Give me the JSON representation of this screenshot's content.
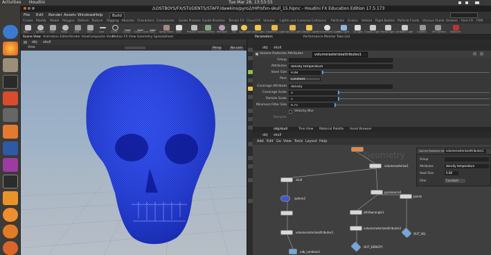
{
  "system": {
    "app_name": "Activities",
    "app_menu": "Houdini",
    "clock": "Tue Mar 28, 13:53:55"
  },
  "launcher": {
    "items": [
      "help-icon",
      "firefox-icon",
      "files-icon",
      "terminal-icon",
      "settings-icon",
      "camera-icon",
      "software-icon",
      "bluetooth-icon",
      "screen-icon",
      "houdini-fx-icon",
      "houdini-icon",
      "houdini-alt-icon",
      "houdini-icon-2"
    ]
  },
  "window": {
    "title": "/LOSTBOYS/FX/STUDENTS/STAFF/dawkins/pyro2/HIP/sfxn-skull_15.hipnc - Houdini FX Education Edition 17.5.173"
  },
  "menubar": {
    "items": [
      "File",
      "Edit",
      "Render",
      "Assets",
      "Windows",
      "Help"
    ],
    "desktop": "Build"
  },
  "shelf_tabs": [
    "Create",
    "Modify",
    "Model",
    "Polygon",
    "Deform",
    "Texture",
    "Rigging",
    "Muscles",
    "Characters",
    "Constraints",
    "Guide Process",
    "Guide Brushes",
    "Terrain FX",
    "Cloud FX",
    "Volume",
    "Lights and Cameras",
    "Collisions",
    "Particles",
    "Grains",
    "Vellum",
    "Rigid Bodies",
    "Particle Fluids",
    "Viscous Fluids",
    "Oceans",
    "Pyro FX",
    "FEM",
    "Wires",
    "Crowds",
    "Drive Simulation"
  ],
  "shelf_tools": [
    "Box",
    "Sphere",
    "Tube",
    "Torus",
    "Grid",
    "Null",
    "Line",
    "Circle",
    "Curve",
    "Draw Curve",
    "Path",
    "Spray Paint",
    "Font",
    "Platonic Solids",
    "L-System",
    "Metaball",
    "File",
    "Spot Light",
    "Area Light",
    "Geometry Light",
    "Volume Light",
    "Distant Light",
    "Environment Light",
    "Sky Light",
    "GI Light",
    "Caustic Light",
    "Portal Light",
    "Ambient Light",
    "Camera",
    "VR Camera",
    "Switcher"
  ],
  "pane_tabs_left": [
    "Scene View",
    "Animation Editor",
    "Render View",
    "Composite View",
    "Motion FX View",
    "Geometry Spreadsheet"
  ],
  "pane_tabs_right": [
    "Parameters",
    "Performance Monitor",
    "Take List"
  ],
  "viewport": {
    "path_obj": "obj",
    "path_node": "skull",
    "view_label": "View",
    "persp_label": "Persp",
    "cam_label": "No cam"
  },
  "params": {
    "path_obj": "obj",
    "path_node": "skull",
    "node_type": "Volume Rasterize Attributes",
    "node_name": "volumerasterizeattributes1",
    "rows": [
      {
        "label": "Group",
        "value": ""
      },
      {
        "label": "Attributes",
        "value": "density temperature"
      },
      {
        "label": "Voxel Size",
        "value": "0.08"
      },
      {
        "label": "Pass",
        "value": "Constant"
      },
      {
        "label": "Coverage Attribute",
        "value": "density"
      },
      {
        "label": "Coverage Scale",
        "value": "2"
      },
      {
        "label": "Particle Scale",
        "value": "1"
      },
      {
        "label": "Minimum Filter Size",
        "value": "0.75"
      },
      {
        "label": "",
        "value": "Velocity Blur"
      },
      {
        "label": "Samples",
        "value": ""
      }
    ]
  },
  "network": {
    "tabs": [
      "/obj/skull",
      "Tree View",
      "Material Palette",
      "Asset Browser"
    ],
    "path_obj": "obj",
    "path_node": "skull",
    "menu": [
      "Add",
      "Edit",
      "Go",
      "View",
      "Tools",
      "Layout",
      "Help"
    ],
    "watermark": "Geometry",
    "popup": {
      "title": "Volume Rasterize Attributes",
      "name": "volumerasterizeattributes1",
      "rows": [
        {
          "label": "Group",
          "value": ""
        },
        {
          "label": "Attributes",
          "value": "density temperature"
        },
        {
          "label": "Voxel Size",
          "value": "0.08"
        },
        {
          "label": "Filter",
          "value": "Constant"
        }
      ]
    },
    "nodes": [
      {
        "name": "volumerasterize1"
      },
      {
        "name": "skull"
      },
      {
        "name": "sphere1"
      },
      {
        "name": "pyrosource1"
      },
      {
        "name": "attribwrangle1"
      },
      {
        "name": "volumerasterizeattributes1"
      },
      {
        "name": "OUT_DENSITY"
      },
      {
        "name": "vdb_combine1"
      },
      {
        "name": "points"
      },
      {
        "name": "OUT_VEL"
      }
    ]
  }
}
